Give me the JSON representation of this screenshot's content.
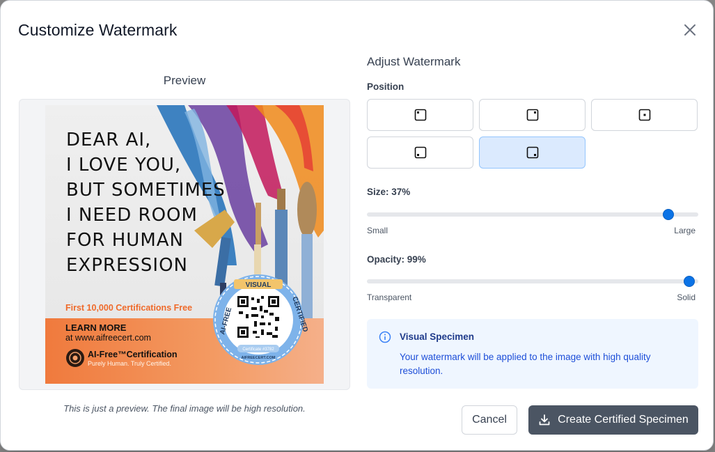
{
  "modal": {
    "title": "Customize Watermark",
    "close_icon": "close-icon"
  },
  "preview": {
    "title": "Preview",
    "note": "This is just a preview. The final image will be high resolution.",
    "poster": {
      "headline": [
        "DEAR AI,",
        "I LOVE YOU,",
        "BUT SOMETIMES",
        "I NEED ROOM",
        "FOR HUMAN",
        "EXPRESSION"
      ],
      "promo": "First 10,000 Certifications Free",
      "learn_more": "LEARN MORE",
      "site": "at www.aifreecert.com",
      "brand": "AI-Free™Certification",
      "tagline": "Purely Human. Truly Certified.",
      "seal_top": "VISUAL",
      "seal_left": "AI-FREE",
      "seal_right": "CERTIFIED",
      "seal_id": "Certificate #3782",
      "seal_bottom": "AIFREECERT.COM"
    }
  },
  "adjust": {
    "title": "Adjust Watermark",
    "position_label": "Position",
    "positions": [
      {
        "id": "top-left",
        "icon": "position-top-left-icon",
        "selected": false
      },
      {
        "id": "top-right",
        "icon": "position-top-right-icon",
        "selected": false
      },
      {
        "id": "center",
        "icon": "position-center-icon",
        "selected": false
      },
      {
        "id": "bottom-left",
        "icon": "position-bottom-left-icon",
        "selected": false
      },
      {
        "id": "bottom-right",
        "icon": "position-bottom-right-icon",
        "selected": true
      }
    ],
    "size": {
      "label": "Size: 37%",
      "value_percent": 37,
      "min_label": "Small",
      "max_label": "Large"
    },
    "opacity": {
      "label": "Opacity: 99%",
      "value_percent": 99,
      "min_label": "Transparent",
      "max_label": "Solid"
    }
  },
  "info": {
    "icon": "info-icon",
    "title": "Visual Specimen",
    "text": "Your watermark will be applied to the image with high quality resolution."
  },
  "actions": {
    "cancel_label": "Cancel",
    "create_label": "Create Certified Specimen",
    "create_icon": "download-icon"
  },
  "colors": {
    "accent": "#0b73e6",
    "primary_button": "#4b5563",
    "selected_position_bg": "#dbeafe",
    "info_bg": "#eff6ff",
    "info_text": "#1d4ed8",
    "promo_orange": "#ef6a2a"
  }
}
